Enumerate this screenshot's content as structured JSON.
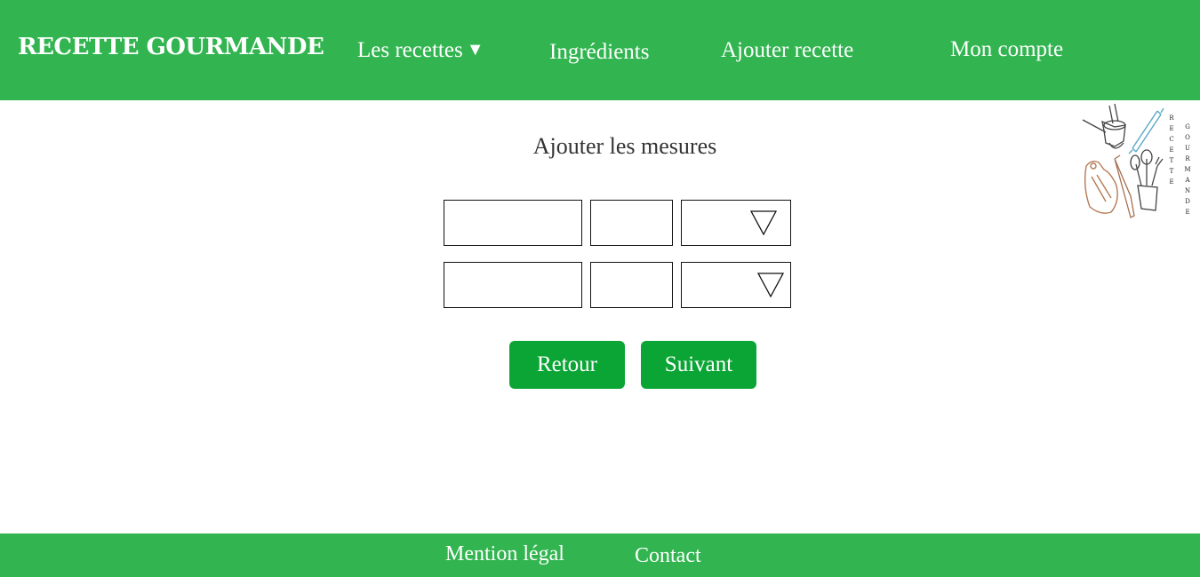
{
  "header": {
    "brand": "RECETTE GOURMANDE",
    "nav": {
      "recettes": "Les recettes",
      "recettes_caret": "▼",
      "ingredients": "Ingrédients",
      "ajouter": "Ajouter recette",
      "compte": "Mon compte"
    }
  },
  "logo": {
    "word1": [
      "R",
      "E",
      "C",
      "E",
      "T",
      "T",
      "E"
    ],
    "word2": [
      "G",
      "O",
      "U",
      "R",
      "M",
      "A",
      "N",
      "D",
      "E"
    ]
  },
  "main": {
    "title": "Ajouter les mesures",
    "rows": [
      {
        "ingredient": "",
        "quantity": "",
        "unit": ""
      },
      {
        "ingredient": "",
        "quantity": "",
        "unit": ""
      }
    ],
    "buttons": {
      "back": "Retour",
      "next": "Suivant"
    }
  },
  "footer": {
    "mention": "Mention légal",
    "contact": "Contact"
  },
  "colors": {
    "header_green": "#32b550",
    "button_green": "#0aa535",
    "text_dark": "#333333"
  },
  "icons": {
    "dropdown": "triangle-down-outline-icon",
    "logo": "kitchen-utensils-illustration"
  }
}
